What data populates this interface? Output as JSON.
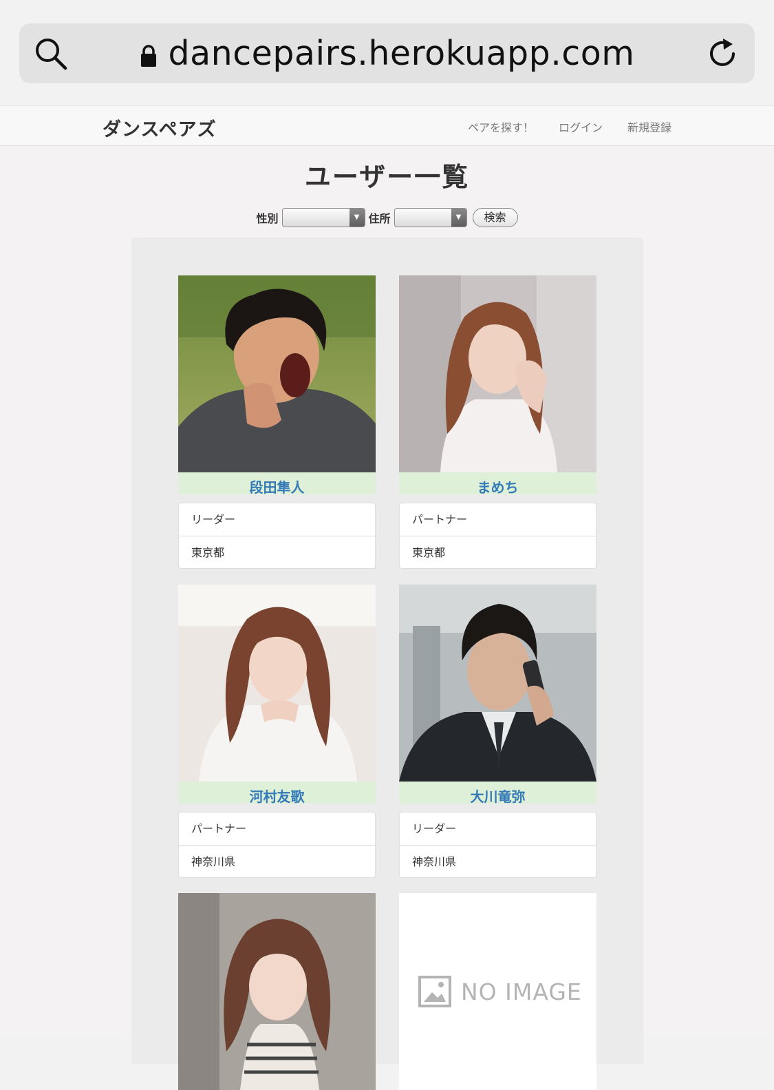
{
  "browser": {
    "url": "dancepairs.herokuapp.com"
  },
  "nav": {
    "brand": "ダンスペアズ",
    "links": [
      "ペアを探す！",
      "ログイン",
      "新規登録"
    ]
  },
  "page": {
    "title": "ユーザー一覧"
  },
  "filter": {
    "gender_label": "性別",
    "gender_value": "",
    "address_label": "住所",
    "address_value": "",
    "search_label": "検索"
  },
  "users": [
    {
      "name": "段田隼人",
      "role": "リーダー",
      "area": "東京都",
      "photo": "man-curly-hair-shouting"
    },
    {
      "name": "まめち",
      "role": "パートナー",
      "area": "東京都",
      "photo": "woman-long-brown-hair"
    },
    {
      "name": "河村友歌",
      "role": "パートナー",
      "area": "神奈川県",
      "photo": "woman-smiling-white-sweater"
    },
    {
      "name": "大川竜弥",
      "role": "リーダー",
      "area": "神奈川県",
      "photo": "man-suit-phone-call"
    },
    {
      "name": "",
      "role": "",
      "area": "",
      "photo": "woman-bob-haircut"
    },
    {
      "name": "",
      "role": "",
      "area": "",
      "photo": "no-image",
      "placeholder_text": "NO IMAGE"
    }
  ],
  "colors": {
    "name_bar_bg": "#dff0d8",
    "name_text": "#337ab7"
  }
}
